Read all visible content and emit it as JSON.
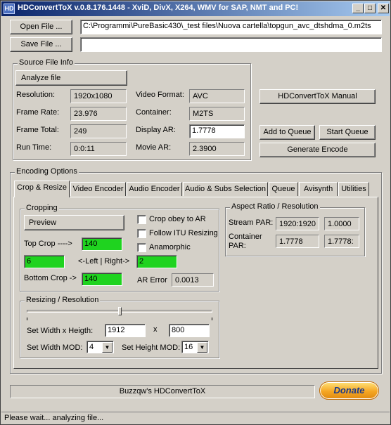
{
  "window": {
    "title": "HDConvertToX v.0.8.176.1448 - XviD, DivX, X264, WMV for SAP, NMT and PC!",
    "icon_text": "HD",
    "minimize": "_",
    "maximize": "□",
    "close": "✕"
  },
  "top": {
    "open_label": "Open File ...",
    "save_label": "Save File ...",
    "input_path": "C:\\Programmi\\PureBasic430\\_test files\\Nuova cartella\\topgun_avc_dtshdma_0.m2ts",
    "output_path": ""
  },
  "source_info": {
    "group_title": "Source File Info",
    "analyze_label": "Analyze file",
    "resolution_label": "Resolution:",
    "resolution_value": "1920x1080",
    "framerate_label": "Frame Rate:",
    "framerate_value": "23.976",
    "frametotal_label": "Frame Total:",
    "frametotal_value": "249",
    "runtime_label": "Run Time:",
    "runtime_value": "0:0:11",
    "videoformat_label": "Video Format:",
    "videoformat_value": "AVC",
    "container_label": "Container:",
    "container_value": "M2TS",
    "displayar_label": "Display AR:",
    "displayar_value": "1.7778",
    "moviear_label": "Movie AR:",
    "moviear_value": "2.3900"
  },
  "right_buttons": {
    "manual": "HDConvertToX Manual",
    "add_queue": "Add to Queue",
    "start_queue": "Start Queue",
    "generate": "Generate Encode"
  },
  "encoding": {
    "group_title": "Encoding Options",
    "tabs": [
      "Crop & Resize",
      "Video Encoder",
      "Audio Encoder",
      "Audio & Subs Selection",
      "Queue",
      "Avisynth",
      "Utilities"
    ]
  },
  "cropping": {
    "group_title": "Cropping",
    "preview_label": "Preview",
    "top_label": "Top Crop ---->",
    "top_value": "140",
    "left_value": "6",
    "leftright_label": "<-Left | Right->",
    "right_value": "2",
    "bottom_label": "Bottom Crop ->",
    "bottom_value": "140",
    "chk_obey": "Crop obey to AR",
    "chk_itu": "Follow ITU Resizing",
    "chk_anamorphic": "Anamorphic",
    "ar_error_label": "AR Error",
    "ar_error_value": "0.0013"
  },
  "aspect": {
    "group_title": "Aspect Ratio  / Resolution",
    "stream_par_label": "Stream PAR:",
    "stream_par_value": "1920:1920",
    "stream_par_value2": "1.0000",
    "container_par_label": "Container\nPAR:",
    "container_par_value": "1.7778",
    "container_par_value2": "1.7778:"
  },
  "resizing": {
    "group_title": "Resizing / Resolution",
    "slider_fraction": 0.5,
    "wh_label": "Set Width x Heigth:",
    "width_value": "1912",
    "x_label": "x",
    "height_value": "800",
    "width_mod_label": "Set Width MOD:",
    "width_mod_value": "4",
    "height_mod_label": "Set Height MOD:",
    "height_mod_value": "16"
  },
  "footer": {
    "credit": "Buzzqw's HDConvertToX",
    "donate_label": "Donate",
    "status": "Please wait... analyzing file..."
  }
}
